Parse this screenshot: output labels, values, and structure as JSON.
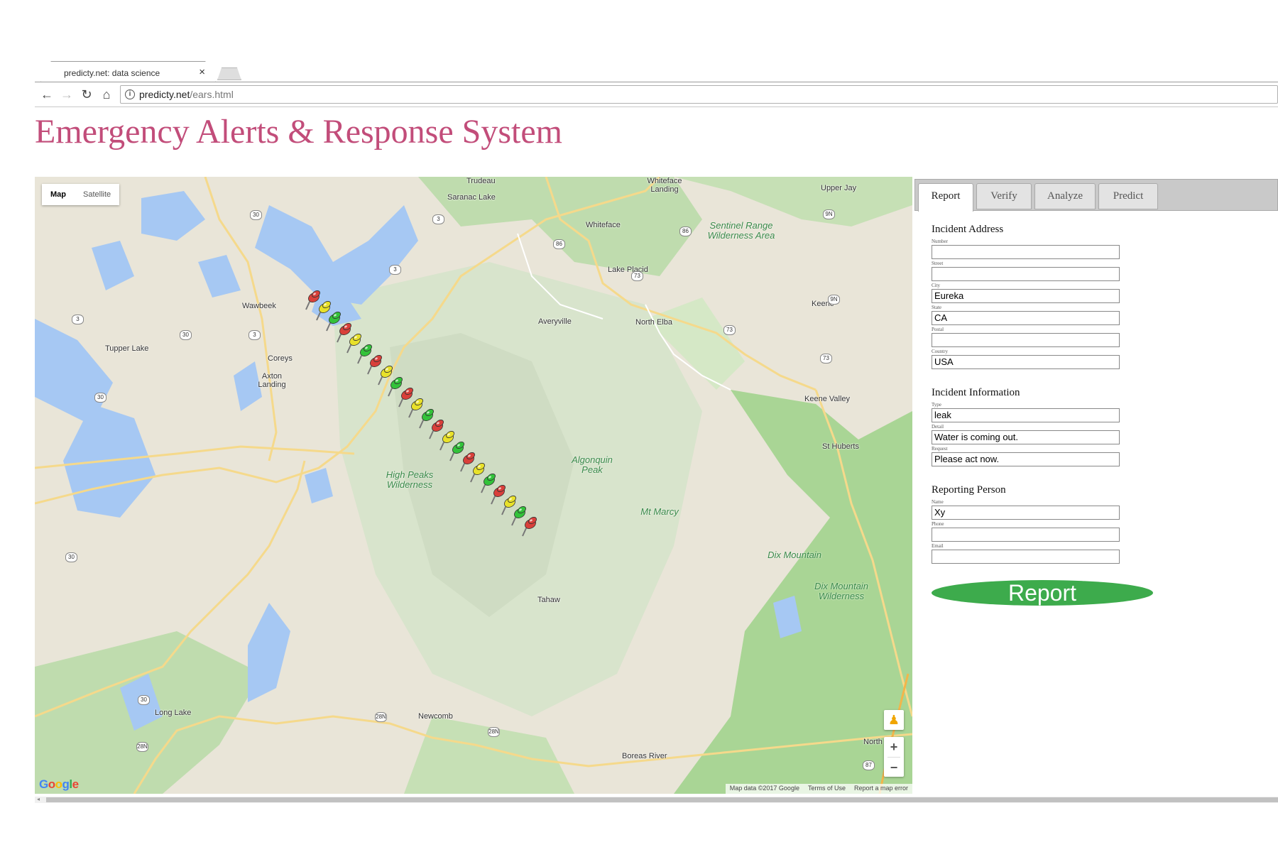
{
  "browser": {
    "tab_title": "predicty.net: data science",
    "tab_close": "×",
    "url_host": "predicty.net",
    "url_path": "/ears.html",
    "back": "←",
    "forward": "→",
    "reload": "↻",
    "home": "⌂",
    "info": "i"
  },
  "page": {
    "title": "Emergency Alerts & Response System"
  },
  "map": {
    "type_control": {
      "map": "Map",
      "satellite": "Satellite"
    },
    "places": [
      {
        "name": "Trudeau"
      },
      {
        "name": "Saranac Lake"
      },
      {
        "name": "Whiteface Landing"
      },
      {
        "name": "Upper Jay"
      },
      {
        "name": "Whiteface"
      },
      {
        "name": "Lake Placid"
      },
      {
        "name": "Wawbeek"
      },
      {
        "name": "Averyville"
      },
      {
        "name": "North Elba"
      },
      {
        "name": "Keene"
      },
      {
        "name": "Tupper Lake"
      },
      {
        "name": "Coreys"
      },
      {
        "name": "Axton Landing"
      },
      {
        "name": "Keene Valley"
      },
      {
        "name": "St Huberts"
      },
      {
        "name": "Tahaw"
      },
      {
        "name": "Long Lake"
      },
      {
        "name": "Newcomb"
      },
      {
        "name": "Boreas River"
      },
      {
        "name": "North"
      }
    ],
    "parks": [
      {
        "name": "Sentinel Range Wilderness Area"
      },
      {
        "name": "High Peaks Wilderness"
      },
      {
        "name": "Algonquin Peak"
      },
      {
        "name": "Mt Marcy"
      },
      {
        "name": "Dix Mountain"
      },
      {
        "name": "Dix Mountain Wilderness"
      }
    ],
    "routes": [
      "30",
      "3",
      "3",
      "86",
      "86",
      "73",
      "73",
      "9N",
      "9N",
      "73",
      "3",
      "30",
      "3",
      "30",
      "30",
      "30",
      "28N",
      "28N",
      "28N",
      "87"
    ],
    "pins": [
      "red",
      "yellow",
      "green",
      "red",
      "yellow",
      "green",
      "red",
      "yellow",
      "green",
      "red",
      "yellow",
      "green",
      "red",
      "yellow",
      "green",
      "red",
      "yellow",
      "green",
      "red",
      "yellow",
      "green",
      "red"
    ],
    "pin_colors": {
      "red": "#d9403a",
      "yellow": "#e8e12a",
      "green": "#33c23a"
    },
    "zoom_in": "+",
    "zoom_out": "−",
    "pegman": "♟",
    "google_logo": "Google",
    "attribution": {
      "data": "Map data ©2017 Google",
      "terms": "Terms of Use",
      "error": "Report a map error"
    },
    "colors": {
      "land": "#e9e5d8",
      "water": "#a6c8f3",
      "forest": "#bfdcae",
      "park": "#d5e8c6",
      "road": "#f5d98b"
    }
  },
  "panel": {
    "tabs": [
      {
        "label": "Report",
        "active": true
      },
      {
        "label": "Verify",
        "active": false
      },
      {
        "label": "Analyze",
        "active": false
      },
      {
        "label": "Predict",
        "active": false
      }
    ],
    "address": {
      "title": "Incident Address",
      "fields": [
        {
          "label": "Number",
          "value": ""
        },
        {
          "label": "Street",
          "value": ""
        },
        {
          "label": "City",
          "value": "Eureka"
        },
        {
          "label": "State",
          "value": "CA"
        },
        {
          "label": "Postal",
          "value": ""
        },
        {
          "label": "Country",
          "value": "USA"
        }
      ]
    },
    "info": {
      "title": "Incident Information",
      "fields": [
        {
          "label": "Type",
          "value": "leak"
        },
        {
          "label": "Detail",
          "value": "Water is coming out."
        },
        {
          "label": "Request",
          "value": "Please act now."
        }
      ]
    },
    "person": {
      "title": "Reporting Person",
      "fields": [
        {
          "label": "Name",
          "value": "Xy"
        },
        {
          "label": "Phone",
          "value": ""
        },
        {
          "label": "Email",
          "value": ""
        }
      ]
    },
    "report_button": "Report"
  }
}
